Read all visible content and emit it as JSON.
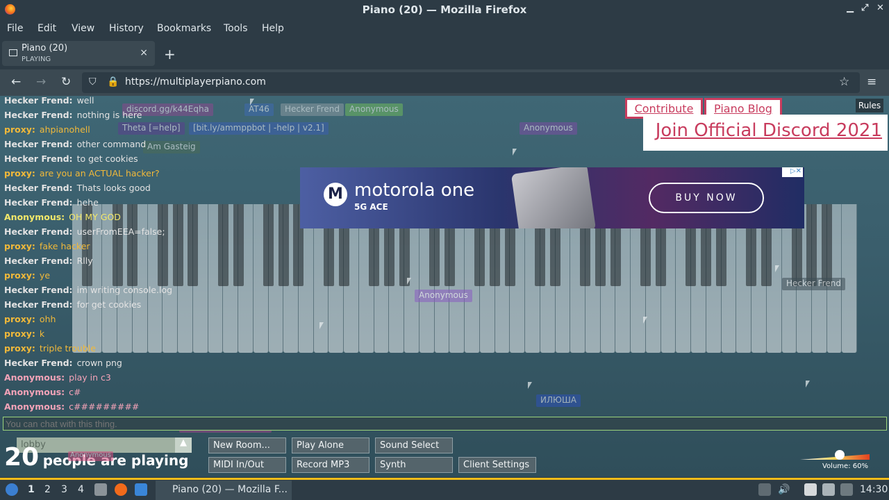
{
  "window": {
    "title": "Piano (20) — Mozilla Firefox"
  },
  "menu": [
    "File",
    "Edit",
    "View",
    "History",
    "Bookmarks",
    "Tools",
    "Help"
  ],
  "tab": {
    "title": "Piano (20)",
    "subtitle": "PLAYING",
    "close": "×",
    "new": "+"
  },
  "nav": {
    "url": "https://multiplayerpiano.com",
    "back": "←",
    "forward": "→",
    "reload": "↻",
    "star": "☆",
    "menu": "≡"
  },
  "chat": [
    {
      "name": "Hecker Frend:",
      "text": "well",
      "color": "#e3e3e3"
    },
    {
      "name": "Hecker Frend:",
      "text": "nothing is here",
      "color": "#e3e3e3"
    },
    {
      "name": "proxy:",
      "text": "ahpianohell",
      "color": "#f1b93a"
    },
    {
      "name": "Hecker Frend:",
      "text": "other command",
      "color": "#e3e3e3"
    },
    {
      "name": "Hecker Frend:",
      "text": "to get cookies",
      "color": "#e3e3e3"
    },
    {
      "name": "proxy:",
      "text": "are you an ACTUAL hacker?",
      "color": "#f1b93a"
    },
    {
      "name": "Hecker Frend:",
      "text": "Thats looks good",
      "color": "#e3e3e3"
    },
    {
      "name": "Hecker Frend:",
      "text": "hehe",
      "color": "#e3e3e3"
    },
    {
      "name": "Anonymous:",
      "text": "OH MY GOD",
      "color": "#f3e86a"
    },
    {
      "name": "Hecker Frend:",
      "text": "userFromEEA=false;",
      "color": "#e3e3e3"
    },
    {
      "name": "proxy:",
      "text": "fake hacker",
      "color": "#f1b93a"
    },
    {
      "name": "Hecker Frend:",
      "text": "Rlly",
      "color": "#e3e3e3"
    },
    {
      "name": "proxy:",
      "text": "ye",
      "color": "#f1b93a"
    },
    {
      "name": "Hecker Frend:",
      "text": "im writing console.log",
      "color": "#e3e3e3"
    },
    {
      "name": "Hecker Frend:",
      "text": "for get cookies",
      "color": "#e3e3e3"
    },
    {
      "name": "proxy:",
      "text": "ohh",
      "color": "#f1b93a"
    },
    {
      "name": "proxy:",
      "text": "k",
      "color": "#f1b93a"
    },
    {
      "name": "proxy:",
      "text": "triple trouble",
      "color": "#f1b93a"
    },
    {
      "name": "Hecker Frend:",
      "text": "crown png",
      "color": "#e3e3e3"
    },
    {
      "name": "Anonymous:",
      "text": "play in c3",
      "color": "#f4a3b8"
    },
    {
      "name": "Anonymous:",
      "text": "c#",
      "color": "#f4a3b8"
    },
    {
      "name": "Anonymous:",
      "text": "c#########",
      "color": "#f4a3b8"
    }
  ],
  "badges": [
    {
      "text": "discord.gg/k44Eqha",
      "color": "#8a4a8f"
    },
    {
      "text": "AT46",
      "color": "#3f6bb0"
    },
    {
      "text": "Hecker Frend",
      "color": "#8a99a0"
    },
    {
      "text": "Anonymous",
      "color": "#6fb85e"
    },
    {
      "text": "Theta [=help]",
      "color": "#5b3f8f"
    },
    {
      "text": "[bit.ly/ammppbot | -help | v2.1]",
      "color": "#3b5fb2"
    },
    {
      "text": "Anonymous",
      "color": "#7a4fa3"
    },
    {
      "text": "Am Gasteig",
      "color": "#4a6d57"
    },
    {
      "text": "Hecker Frend",
      "color": "#3e4e56"
    },
    {
      "text": "Anonymous",
      "color": "#8c5dc2"
    },
    {
      "text": "ИЛЮША",
      "color": "#2d52b8"
    },
    {
      "text": "welcometopianohell",
      "color": "#a0498a"
    },
    {
      "text": "Anonymous",
      "color": "#d24a7b"
    }
  ],
  "chat_input": {
    "placeholder": "You can chat with this thing."
  },
  "room": {
    "name": "lobby",
    "arrow": "▲"
  },
  "players": {
    "count": "20",
    "label": "people are playing"
  },
  "buttons": {
    "new_room": "New Room...",
    "play_alone": "Play Alone",
    "sound_select": "Sound Select",
    "midi": "MIDI In/Out",
    "record": "Record MP3",
    "synth": "Synth",
    "client_settings": "Client Settings"
  },
  "links": {
    "contribute": "Contribute",
    "blog": "Piano Blog",
    "discord": "Join Official Discord 2021",
    "rules": "Rules"
  },
  "ad": {
    "brand": "motorola one",
    "sub": "5G ACE",
    "cta": "BUY NOW",
    "choices": "▷✕"
  },
  "volume": {
    "label": "Volume: 60%",
    "level": 0.6
  },
  "taskbar": {
    "workspaces": [
      "1",
      "2",
      "3",
      "4"
    ],
    "task": "Piano (20) — Mozilla F...",
    "clock": "14:30"
  },
  "colors": {
    "accent": "#c83c5e",
    "chat_border": "#9bd37c",
    "taskbar_accent": "#f2bd1a"
  }
}
